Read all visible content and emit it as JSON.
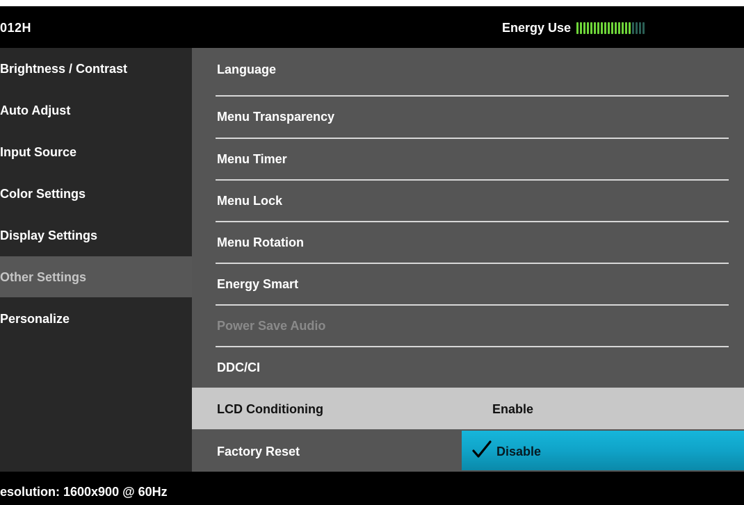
{
  "header": {
    "model": "012H",
    "energy_label": "Energy Use",
    "energy_level_fraction": 0.8
  },
  "left_menu": {
    "items": [
      {
        "label": "Brightness / Contrast"
      },
      {
        "label": "Auto Adjust"
      },
      {
        "label": "Input Source"
      },
      {
        "label": "Color Settings"
      },
      {
        "label": "Display Settings"
      },
      {
        "label": "Other Settings",
        "selected": true
      },
      {
        "label": "Personalize"
      }
    ]
  },
  "right_menu": {
    "items": [
      {
        "label": "Language"
      },
      {
        "label": "Menu Transparency"
      },
      {
        "label": "Menu Timer"
      },
      {
        "label": "Menu Lock"
      },
      {
        "label": "Menu Rotation"
      },
      {
        "label": "Energy Smart"
      },
      {
        "label": "Power Save Audio",
        "disabled": true
      },
      {
        "label": "DDC/CI"
      },
      {
        "label": "LCD Conditioning",
        "value": "Enable",
        "highlighted": true
      },
      {
        "label": "Factory Reset"
      }
    ],
    "option_selected": {
      "label": "Disable",
      "icon": "checkmark-icon"
    }
  },
  "footer": {
    "resolution": "esolution: 1600x900 @ 60Hz"
  },
  "colors": {
    "background": "#000000",
    "left_panel": "#282828",
    "left_selected": "#575757",
    "right_panel": "#555555",
    "highlight_row": "#c8c8c8",
    "option_accent": "#10a3c8",
    "meter_on": "#6fd63a",
    "meter_off": "#2b5f55"
  }
}
